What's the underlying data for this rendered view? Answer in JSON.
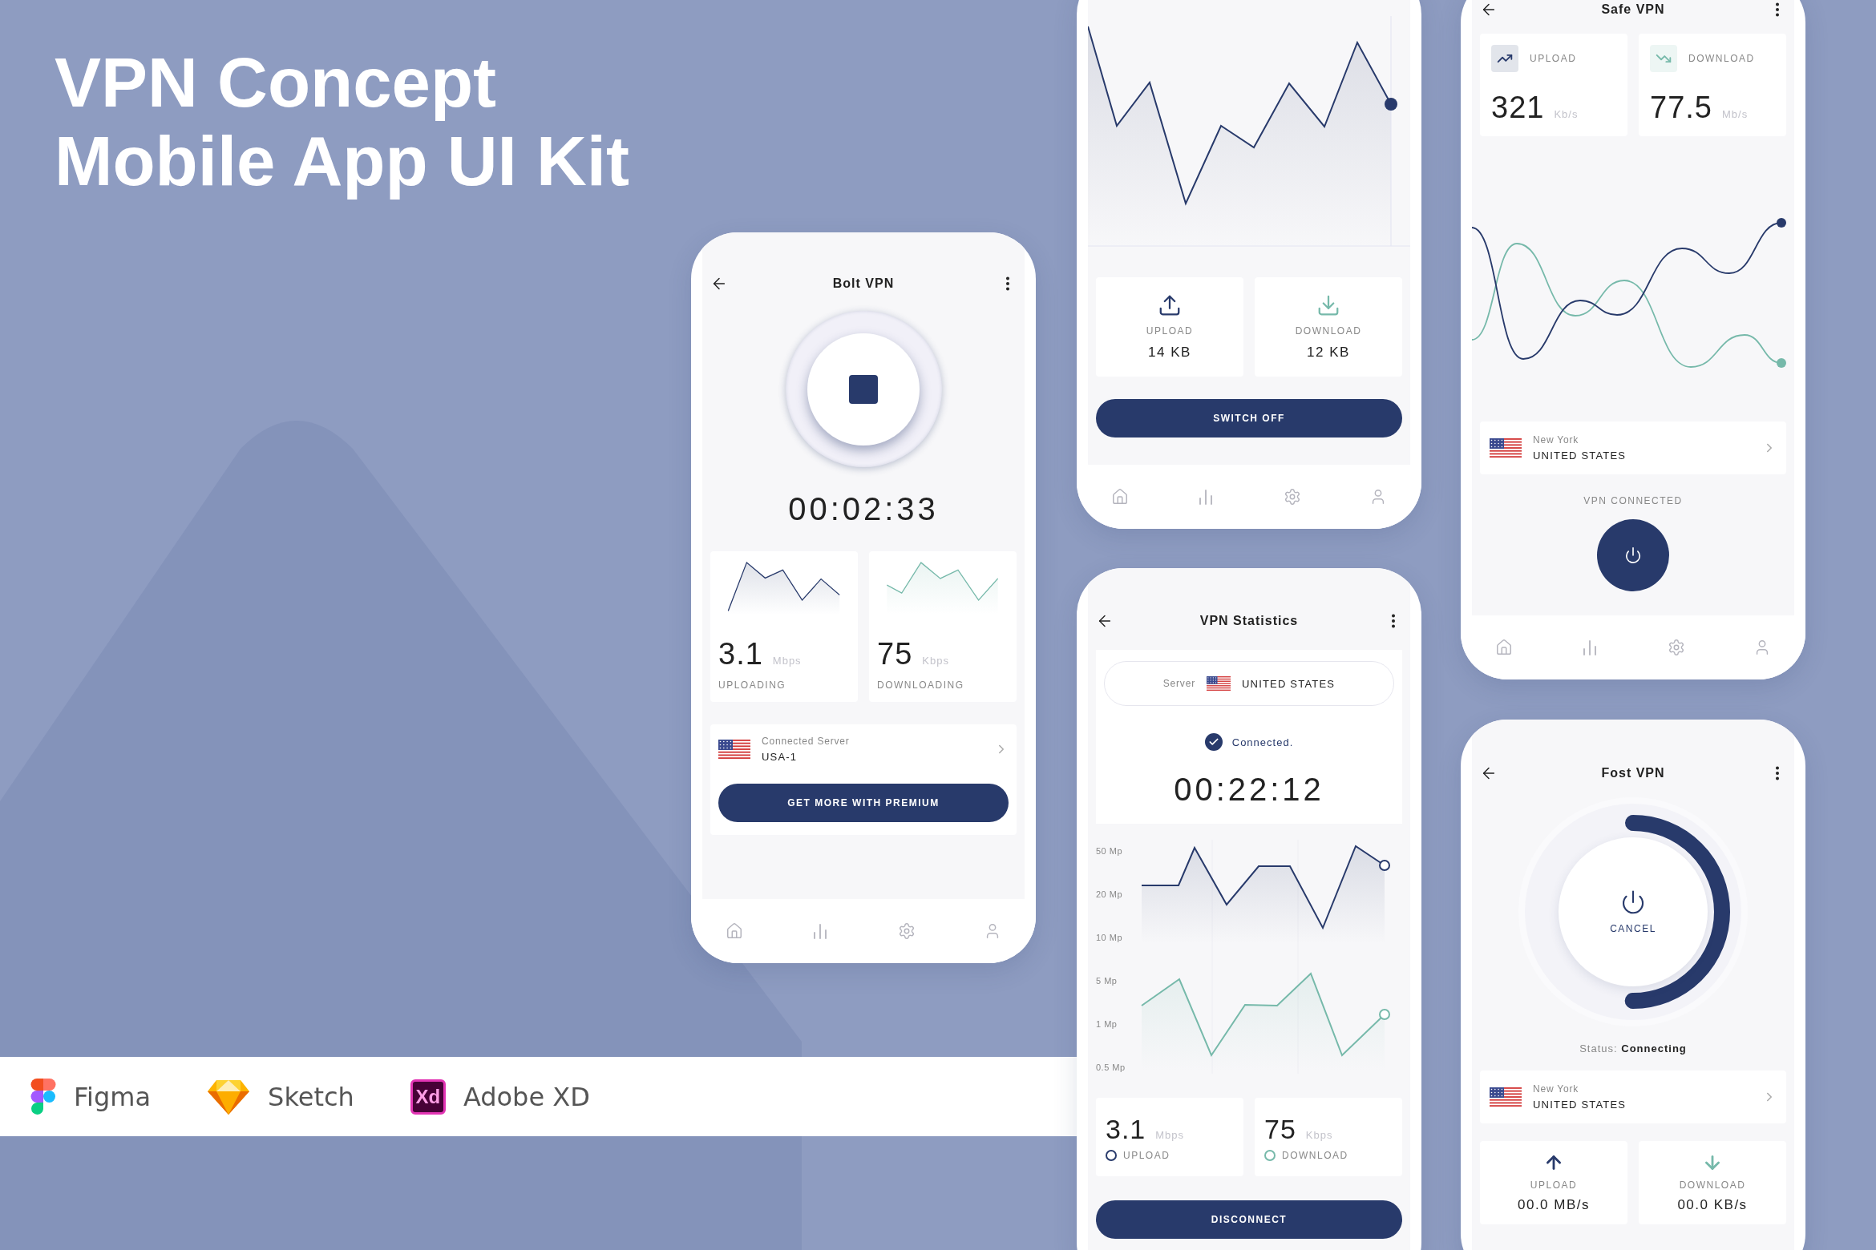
{
  "title_lines": [
    "VPN Concept",
    "Mobile App UI Kit"
  ],
  "tools": [
    {
      "kind": "figma",
      "label": "Figma"
    },
    {
      "kind": "sketch",
      "label": "Sketch"
    },
    {
      "kind": "xd",
      "label": "Adobe XD",
      "logo_text": "Xd"
    }
  ],
  "bolt_screen": {
    "title": "Bolt VPN",
    "timer": "00:02:33",
    "stats": [
      {
        "value": "3.1",
        "unit": "Mbps",
        "label": "UPLOADING",
        "color": "#283a6b"
      },
      {
        "value": "75",
        "unit": "Kbps",
        "label": "DOWNLOADING",
        "color": "#76b9aa"
      }
    ],
    "server": {
      "caption": "Connected Server",
      "name": "USA-1"
    },
    "button": "GET MORE WITH PREMIUM"
  },
  "switch_screen": {
    "stats": [
      {
        "kind": "upload",
        "label": "UPLOAD",
        "value": "14 KB",
        "color": "#283a6b"
      },
      {
        "kind": "download",
        "label": "DOWNLOAD",
        "value": "12 KB",
        "color": "#76b9aa"
      }
    ],
    "button": "SWITCH OFF"
  },
  "statistics_screen": {
    "title": "VPN Statistics",
    "server_label": "Server",
    "country": "UNITED STATES",
    "status": "Connected.",
    "timer": "00:22:12",
    "axis_labels": [
      "50 Mp",
      "20 Mp",
      "10 Mp",
      "5 Mp",
      "1 Mp",
      "0.5 Mp"
    ],
    "stats": [
      {
        "value": "3.1",
        "unit": "Mbps",
        "label": "UPLOAD",
        "color": "#283a6b"
      },
      {
        "value": "75",
        "unit": "Kbps",
        "label": "DOWNLOAD",
        "color": "#76b9aa"
      }
    ],
    "button": "DISCONNECT"
  },
  "safe_screen": {
    "title": "Safe VPN",
    "stats": [
      {
        "kind": "upload",
        "label": "UPLOAD",
        "value": "321",
        "unit": "Kb/s",
        "color": "#283a6b"
      },
      {
        "kind": "download",
        "label": "DOWNLOAD",
        "value": "77.5",
        "unit": "Mb/s",
        "color": "#76b9aa"
      }
    ],
    "location": {
      "city": "New York",
      "country": "UNITED STATES"
    },
    "status": "VPN CONNECTED"
  },
  "fost_screen": {
    "title": "Fost VPN",
    "progress": {
      "level": 0.5,
      "label": "CANCEL"
    },
    "status": "Status: **Connecting**",
    "location": {
      "city": "New York",
      "country": "UNITED STATES"
    },
    "stats": [
      {
        "kind": "upload",
        "label": "UPLOAD",
        "value": "00.0 MB/s",
        "color": "#283a6b"
      },
      {
        "kind": "download",
        "label": "DOWNLOAD",
        "value": "00.0 KB/s",
        "color": "#76b9aa"
      }
    ]
  }
}
